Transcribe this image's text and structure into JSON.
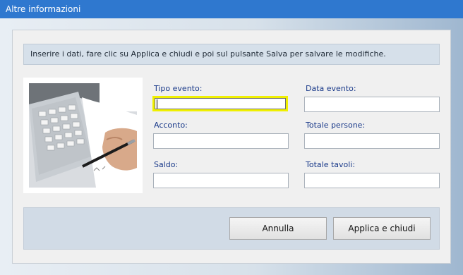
{
  "window": {
    "title": "Altre informazioni"
  },
  "info": {
    "text": "Inserire i dati, fare clic su Applica e chiudi e poi sul pulsante Salva per salvare le modifiche."
  },
  "image": {
    "icon": "calculator-hand-photo"
  },
  "fields": {
    "tipo_evento": {
      "label": "Tipo evento:",
      "value": ""
    },
    "data_evento": {
      "label": "Data evento:",
      "value": ""
    },
    "acconto": {
      "label": "Acconto:",
      "value": ""
    },
    "totale_persone": {
      "label": "Totale persone:",
      "value": ""
    },
    "saldo": {
      "label": "Saldo:",
      "value": ""
    },
    "totale_tavoli": {
      "label": "Totale tavoli:",
      "value": ""
    }
  },
  "buttons": {
    "cancel": "Annulla",
    "apply": "Applica e chiudi"
  },
  "colors": {
    "titlebar": "#2f78cf",
    "label": "#1a3a8a",
    "focus": "#f0f000"
  }
}
